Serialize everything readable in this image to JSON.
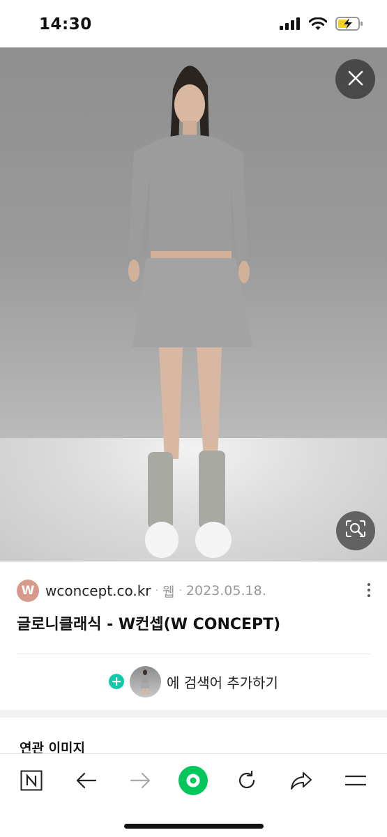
{
  "status_bar": {
    "time": "14:30",
    "icons": [
      "signal-icon",
      "wifi-icon",
      "battery-charging-icon"
    ]
  },
  "image_viewer": {
    "close_icon": "close-icon",
    "lens_icon": "image-search-icon"
  },
  "result": {
    "source_logo_letter": "W",
    "source_domain": "wconcept.co.kr",
    "separator": "·",
    "source_type": "웹",
    "date": "2023.05.18.",
    "more_icon": "more-vertical-icon",
    "title": "글로니클래식 - W컨셉(W CONCEPT)"
  },
  "add_search": {
    "label": "에 검색어 추가하기",
    "plus_icon": "plus-icon"
  },
  "related": {
    "title": "연관 이미지"
  },
  "bottom_nav": {
    "items": [
      "naver-home-icon",
      "back-arrow-icon",
      "forward-arrow-icon",
      "green-dot-icon",
      "refresh-icon",
      "share-icon",
      "menu-icon"
    ]
  },
  "colors": {
    "accent_green": "#03c75a",
    "plus_teal": "#10c9a8",
    "logo_pink": "#d79a8a"
  }
}
